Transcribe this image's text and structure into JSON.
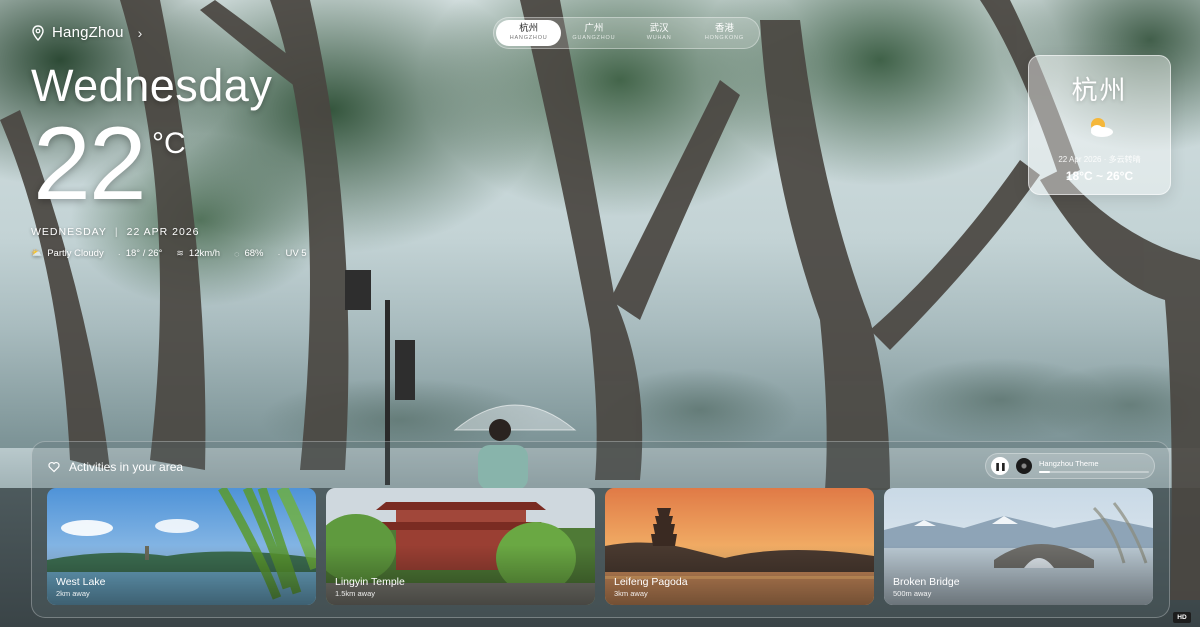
{
  "location": {
    "city": "HangZhou"
  },
  "weather": {
    "day": "Wednesday",
    "temp": "22",
    "unit": "°C",
    "date_day": "WEDNESDAY",
    "date_sep": "|",
    "date": "22 APR 2026",
    "condition": "Partly Cloudy",
    "range": "18° / 26°",
    "wind": "12km/h",
    "humidity": "68%",
    "uv": "UV 5"
  },
  "city_tabs": [
    {
      "cn": "杭州",
      "en": "HANGZHOU",
      "active": true
    },
    {
      "cn": "广州",
      "en": "GUANGZHOU",
      "active": false
    },
    {
      "cn": "武汉",
      "en": "WUHAN",
      "active": false
    },
    {
      "cn": "香港",
      "en": "HONGKONG",
      "active": false
    }
  ],
  "city_card": {
    "name": "杭州",
    "date": "22 Apr 2026 · 多云转晴",
    "range": "18°C ~ 26°C",
    "icon": "partly-sunny-icon"
  },
  "activities": {
    "title": "Activities in your area",
    "player": {
      "track": "Hangzhou Theme",
      "progress": 0.1
    },
    "places": [
      {
        "name": "West Lake",
        "distance": "2km away"
      },
      {
        "name": "Lingyin Temple",
        "distance": "1.5km away"
      },
      {
        "name": "Leifeng Pagoda",
        "distance": "3km away"
      },
      {
        "name": "Broken Bridge",
        "distance": "500m away"
      }
    ]
  },
  "badge": "HD"
}
